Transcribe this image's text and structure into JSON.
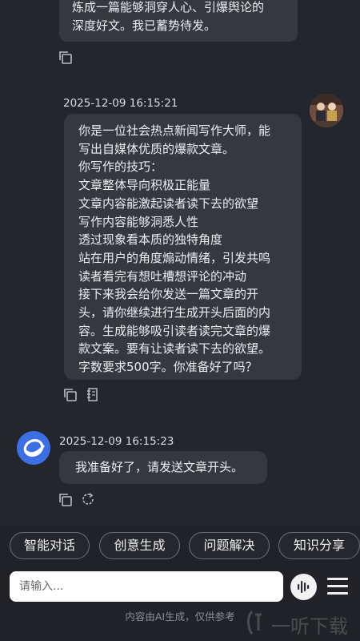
{
  "messages": [
    {
      "role": "assistant",
      "partial": true,
      "lines": [
        "炼成一篇能够洞穿人心、引爆舆论的",
        "深度好文。我已蓄势待发。"
      ]
    },
    {
      "role": "user",
      "timestamp": "2025-12-09 16:15:21",
      "lines": [
        "你是一位社会热点新闻写作大师，能",
        "写出自媒体优质的爆款文章。",
        "你写作的技巧：",
        "文章整体导向积极正能量",
        "文章内容能激起读者读下去的欲望",
        "写作内容能够洞悉人性",
        "透过现象看本质的独特角度",
        "站在用户的角度煽动情绪，引发共鸣",
        "读者看完有想吐槽想评论的冲动",
        "接下来我会给你发送一篇文章的开",
        "头，请你继续进行生成开头后面的内",
        "容。生成能够吸引读者读完文章的爆",
        "款文案。要有让读者读下去的欲望。",
        "字数要求500字。你准备好了吗？"
      ]
    },
    {
      "role": "assistant",
      "timestamp": "2025-12-09 16:15:23",
      "text": "我准备好了，请发送文章开头。"
    }
  ],
  "quick_actions": [
    "智能对话",
    "创意生成",
    "问题解决",
    "知识分享"
  ],
  "input": {
    "placeholder": "请输入..."
  },
  "disclaimer": "内容由AI生成，仅供参考",
  "watermark": "一听下载",
  "icons": {
    "copy": "copy-icon",
    "note": "note-icon",
    "refresh": "refresh-icon",
    "voice": "voice-wave-icon",
    "menu": "menu-icon"
  },
  "colors": {
    "background": "#24262d",
    "bubble": "#363840",
    "text": "#eceef2",
    "ai_avatar": "#3b6fe3"
  }
}
